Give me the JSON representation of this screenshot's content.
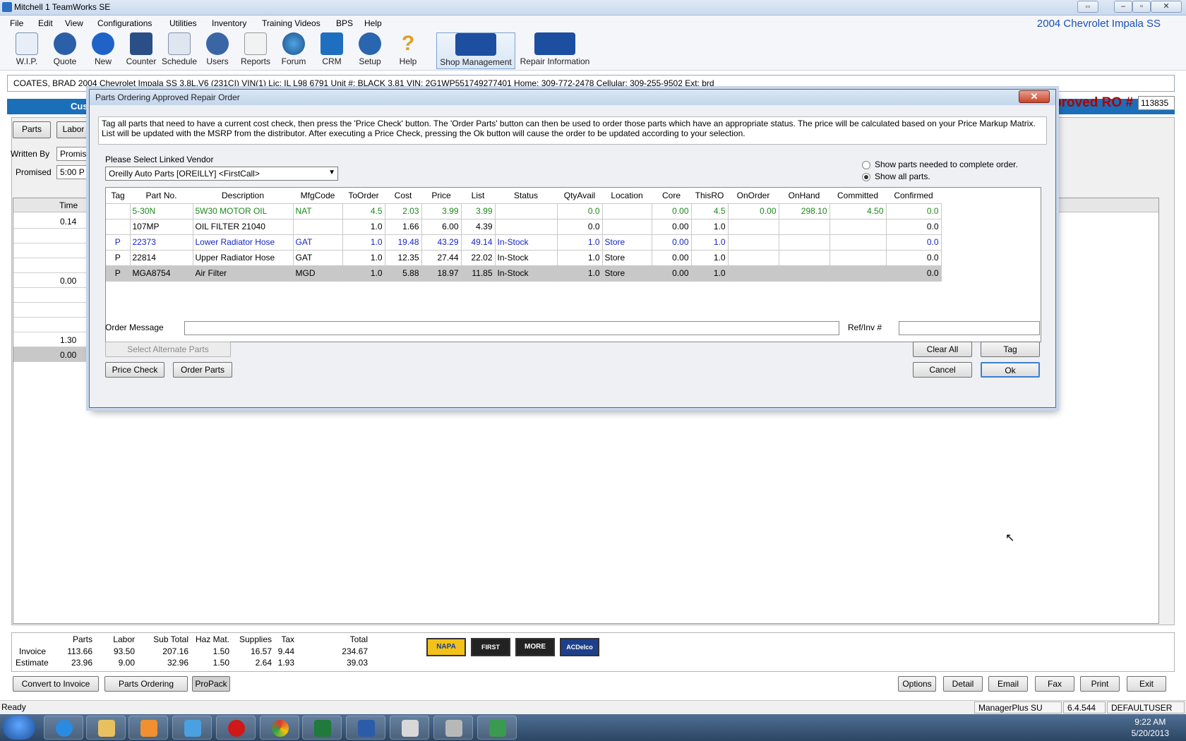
{
  "window": {
    "title": "Mitchell 1 TeamWorks SE",
    "vehicle": "2004 Chevrolet Impala SS"
  },
  "menu": [
    "File",
    "Edit",
    "View",
    "Configurations",
    "Utilities",
    "Inventory",
    "Training Videos",
    "BPS",
    "Help"
  ],
  "toolbar": [
    "W.I.P.",
    "Quote",
    "New",
    "Counter",
    "Schedule",
    "Users",
    "Reports",
    "Forum",
    "CRM",
    "Setup",
    "Help",
    "Shop Management",
    "Repair Information"
  ],
  "customer_bar": "COATES, BRAD   2004  Chevrolet Impala SS  3.8L,V6 (231CI) VIN(1) Lic: IL L98 6791  Unit #: BLACK 3.81  VIN: 2G1WP551749277401   Home: 309-772-2478   Cellular: 309-255-9502  Ext: brd",
  "background": {
    "tab_cust": "Custo",
    "ro_label": "proved RO #",
    "ro_number": "113835",
    "parts_tab": "Parts",
    "labor_tab": "Labor",
    "written_by": "Written By",
    "written_by_value": "Promis",
    "promised": "Promised",
    "promised_value": "5:00 P",
    "time_header": "Time",
    "time_values": [
      "0.14",
      "",
      "",
      "",
      "0.00",
      "",
      "",
      "",
      "1.30",
      "0.00"
    ]
  },
  "dialog": {
    "title": "Parts Ordering Approved Repair Order",
    "instructions": "Tag all parts that need to have a current cost check, then press the 'Price Check' button.  The 'Order Parts' button can then be used to order those parts which have an appropriate status.  The price will be calculated based on your Price Markup Matrix. List will be updated with the MSRP from the distributor.  After executing a Price Check, pressing the Ok button will cause the order to be updated according to your selection.",
    "vendor_label": "Please Select Linked Vendor",
    "vendor_value": "Oreilly Auto Parts [OREILLY] <FirstCall>",
    "radio_needed": "Show parts needed to complete order.",
    "radio_all": "Show all parts.",
    "columns": [
      "Tag",
      "Part No.",
      "Description",
      "MfgCode",
      "ToOrder",
      "Cost",
      "Price",
      "List",
      "Status",
      "QtyAvail",
      "Location",
      "Core",
      "ThisRO",
      "OnOrder",
      "OnHand",
      "Committed",
      "Confirmed"
    ],
    "rows": [
      {
        "style": "green",
        "cells": [
          "",
          "5-30N",
          "5W30 MOTOR OIL",
          "NAT",
          "4.5",
          "2.03",
          "3.99",
          "3.99",
          "",
          "0.0",
          "",
          "0.00",
          "4.5",
          "0.00",
          "298.10",
          "4.50",
          "0.0"
        ]
      },
      {
        "style": "black",
        "cells": [
          "",
          "107MP",
          "OIL FILTER 21040",
          "",
          "1.0",
          "1.66",
          "6.00",
          "4.39",
          "",
          "0.0",
          "",
          "0.00",
          "1.0",
          "",
          "",
          "",
          "0.0"
        ]
      },
      {
        "style": "blue",
        "cells": [
          "P",
          "22373",
          "Lower Radiator Hose",
          "GAT",
          "1.0",
          "19.48",
          "43.29",
          "49.14",
          "In-Stock",
          "1.0",
          "Store",
          "0.00",
          "1.0",
          "",
          "",
          "",
          "0.0"
        ]
      },
      {
        "style": "black",
        "cells": [
          "P",
          "22814",
          "Upper Radiator Hose",
          "GAT",
          "1.0",
          "12.35",
          "27.44",
          "22.02",
          "In-Stock",
          "1.0",
          "Store",
          "0.00",
          "1.0",
          "",
          "",
          "",
          "0.0"
        ]
      },
      {
        "style": "sel",
        "cells": [
          "P",
          "MGA8754",
          "Air Filter",
          "MGD",
          "1.0",
          "5.88",
          "18.97",
          "11.85",
          "In-Stock",
          "1.0",
          "Store",
          "0.00",
          "1.0",
          "",
          "",
          "",
          "0.0"
        ]
      }
    ],
    "order_message_label": "Order Message",
    "ref_inv_label": "Ref/Inv #",
    "btn_select_alt": "Select Alternate Parts",
    "btn_price_check": "Price Check",
    "btn_order_parts": "Order Parts",
    "btn_clear_all": "Clear All",
    "btn_tag": "Tag",
    "btn_cancel": "Cancel",
    "btn_ok": "Ok"
  },
  "totals": {
    "headers": [
      "Parts",
      "Labor",
      "Sub Total",
      "Haz Mat.",
      "Supplies",
      "Tax",
      "Total"
    ],
    "invoice_label": "Invoice",
    "invoice": [
      "113.66",
      "93.50",
      "207.16",
      "1.50",
      "16.57",
      "9.44",
      "234.67"
    ],
    "estimate_label": "Estimate",
    "estimate": [
      "23.96",
      "9.00",
      "32.96",
      "1.50",
      "2.64",
      "1.93",
      "39.03"
    ]
  },
  "vendor_logos": [
    "NAPA",
    "FIRST CALL",
    "MORE",
    "ACDelco"
  ],
  "bottom_buttons": {
    "convert": "Convert to Invoice",
    "parts_ordering": "Parts Ordering",
    "propack": "ProPack",
    "options": "Options",
    "detail": "Detail",
    "email": "Email",
    "fax": "Fax",
    "print": "Print",
    "exit": "Exit"
  },
  "status": {
    "left": "Ready",
    "product": "ManagerPlus SU",
    "version": "6.4.544",
    "user": "DEFAULTUSER"
  },
  "clock": {
    "time": "9:22 AM",
    "date": "5/20/2013"
  },
  "colors": {
    "green": "#1a8a1a",
    "blue": "#1427c8",
    "ro_red": "#b00000"
  }
}
